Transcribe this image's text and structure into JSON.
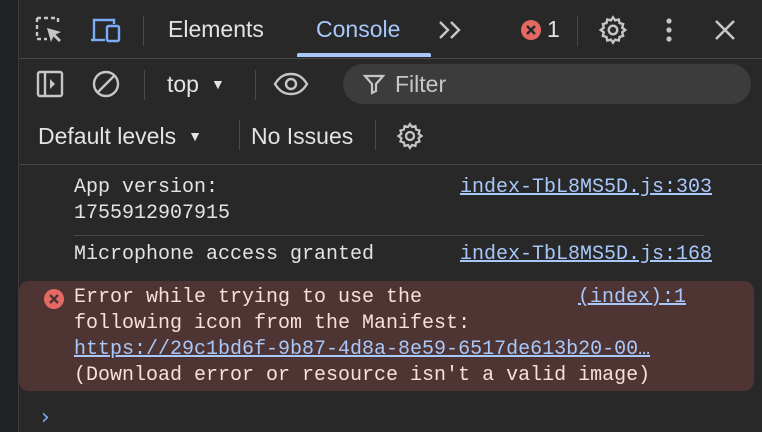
{
  "tabbar": {
    "tabs": [
      {
        "label": "Elements"
      },
      {
        "label": "Console"
      }
    ],
    "more_label": ">>",
    "error_count": "1"
  },
  "toolbar": {
    "context": "top",
    "filter_placeholder": "Filter",
    "levels": "Default levels",
    "issues": "No Issues"
  },
  "messages": [
    {
      "text": "App version:\n1755912907915",
      "source": "index-TbL8MS5D.js:303"
    },
    {
      "text": "Microphone access granted",
      "source": "index-TbL8MS5D.js:168"
    },
    {
      "text": "Error while trying to use the\nfollowing icon from the Manifest:",
      "link": "https://29c1bd6f-9b87-4d8a-8e59-6517de613b20-00…",
      "detail": "(Download error or resource isn't a valid image)",
      "source": "(index):1"
    }
  ],
  "colors": {
    "accent": "#a8c7fa",
    "error": "#e46962",
    "error_bg": "#4e3534",
    "background": "#282828"
  }
}
